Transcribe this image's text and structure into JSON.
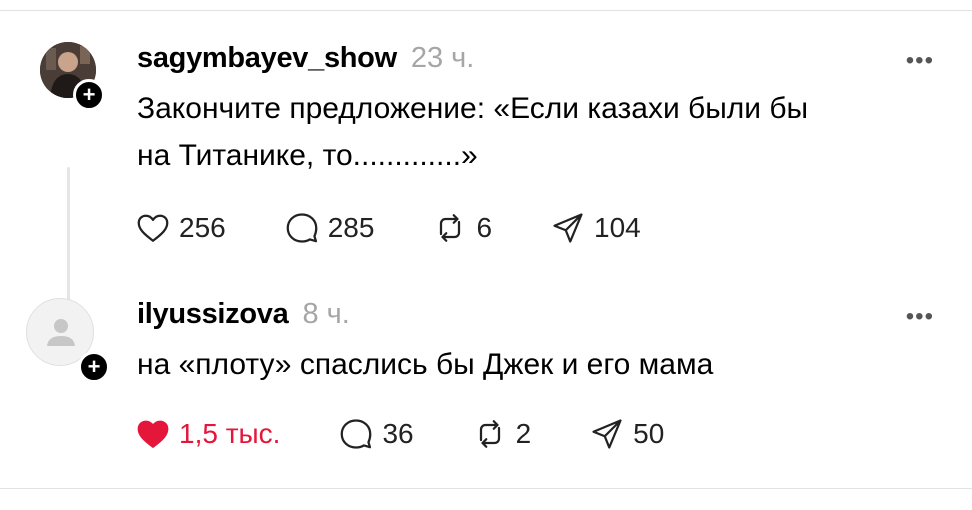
{
  "posts": [
    {
      "username": "sagymbayev_show",
      "time": "23 ч.",
      "text_line1": "Закончите предложение: «Если казахи были бы",
      "text_line2": "на Титанике, то.............»",
      "stats": {
        "likes": "256",
        "comments": "285",
        "reposts": "6",
        "shares": "104"
      },
      "liked": false,
      "avatar_icon": "user-photo-icon"
    },
    {
      "username": "ilyussizova",
      "time": "8 ч.",
      "text_line1": "на «плоту» спаслись бы Джек и его мама",
      "stats": {
        "likes": "1,5 тыс.",
        "comments": "36",
        "reposts": "2",
        "shares": "50"
      },
      "liked": true,
      "avatar_icon": "default-avatar-icon"
    }
  ],
  "colors": {
    "like_active": "#e4163a",
    "muted": "#a6a6a6",
    "divider": "#e2e2e2"
  },
  "icons": {
    "more": "more-dots-icon",
    "follow": "plus-icon",
    "like": "heart-icon",
    "comment": "comment-bubble-icon",
    "repost": "repost-icon",
    "share": "send-icon"
  }
}
